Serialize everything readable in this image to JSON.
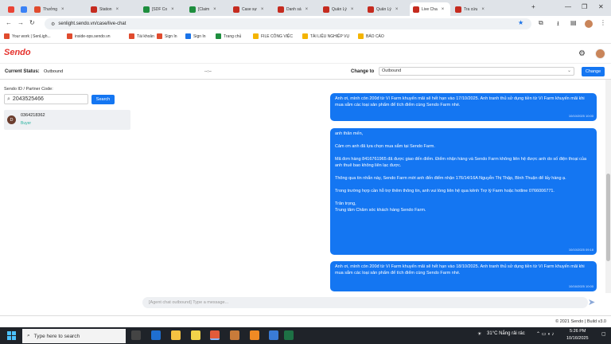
{
  "browser": {
    "tabs": [
      {
        "label": "",
        "color": "#ea4335",
        "icon": "gmail-icon"
      },
      {
        "label": "",
        "color": "#3b82f6",
        "icon": "messenger-icon"
      },
      {
        "label": "Thưởng",
        "color": "#e04b2e",
        "icon": "doc-icon"
      },
      {
        "label": "Station",
        "color": "#c52b1f",
        "icon": "station-icon"
      },
      {
        "label": "[SDF Co",
        "color": "#1e8e3e",
        "icon": "sheet-icon"
      },
      {
        "label": "[Claim",
        "color": "#1e8e3e",
        "icon": "sheet-icon"
      },
      {
        "label": "Case sự",
        "color": "#c52b1f",
        "icon": "station-icon"
      },
      {
        "label": "Danh sá",
        "color": "#c52b1f",
        "icon": "station-icon"
      },
      {
        "label": "Quản Lý",
        "color": "#c52b1f",
        "icon": "station-icon"
      },
      {
        "label": "Quản Lý",
        "color": "#c52b1f",
        "icon": "station-icon"
      },
      {
        "label": "Live Cha",
        "color": "#c52b1f",
        "icon": "station-icon",
        "active": true
      },
      {
        "label": "Tra cứu",
        "color": "#c52b1f",
        "icon": "station-icon"
      }
    ],
    "url": "senlight.sendo.vn/case/live-chat",
    "bookmarks": [
      {
        "label": "Your work | SenLigh...",
        "color": "#e04b2e"
      },
      {
        "label": "inside-ops.sendo.vn",
        "color": "#e04b2e"
      },
      {
        "label": "Tài khoản",
        "color": "#e04b2e"
      },
      {
        "label": "Sign In",
        "color": "#e04b2e"
      },
      {
        "label": "Sign In",
        "color": "#1a73e8"
      },
      {
        "label": "Trang chủ",
        "color": "#1e8e3e"
      },
      {
        "label": "FILE CÔNG VIỆC",
        "color": "#f4b400"
      },
      {
        "label": "TÀI LIỆU NGHIỆP VỤ",
        "color": "#f4b400"
      },
      {
        "label": "BÁO CÁO",
        "color": "#f4b400"
      }
    ]
  },
  "app": {
    "logo": "Sendo",
    "status": {
      "current_label": "Current Status:",
      "current_value": "Outbound",
      "middle_value": "--:--",
      "change_to_label": "Change to",
      "selected": "Outbound",
      "change_button": "Change"
    },
    "left": {
      "field_label": "Sendo ID / Partner Code:",
      "search_value": "2043525466",
      "search_button": "Search",
      "contact": {
        "initial": "D",
        "phone": "0364218362",
        "role": "Buyer"
      }
    },
    "messages": [
      {
        "text": "Anh ơi, mình còn 200đ từ Ví Farm khuyến mãi sẽ hết hạn vào 17/10/2025. Anh tranh thủ sử dụng tiền từ Ví Farm khuyến mãi khi mua sắm các loại sản phẩm để tích điểm cùng Sendo Farm nhé.",
        "time": "10/10/2025 10:00"
      },
      {
        "text": "anh thân mến,\n\nCảm ơn anh đã lựa chọn mua sắm tại Sendo Farm.\n\nMã đơn hàng 8416761965 đã được giao đến điểm. Điểm nhận hàng và Sendo Farm không liên hệ được anh do số điện thoại của anh thuê bao không liên lạc được.\n\nThông qua tin nhắn này, Sendo Farm mời anh đến điểm nhận 176/14/16A Nguyễn Thị Thập, Bình Thuận để lấy hàng ạ.\n\nTrong trường hợp cần hỗ trợ thêm thông tin, anh vui lòng liên hệ qua kênh Trợ lý Farm hoặc hotline 0766006771.\n\nTrân trọng,\nTrung tâm Chăm sóc khách hàng Sendo Farm.",
        "time": "10/10/2025 09:18"
      },
      {
        "text": "Anh ơi, mình còn 200đ từ Ví Farm khuyến mãi sẽ hết hạn vào 18/10/2025. Anh tranh thủ sử dụng tiền từ Ví Farm khuyến mãi khi mua sắm các loại sản phẩm để tích điểm cùng Sendo Farm nhé.",
        "time": "10/16/2025 10:00"
      }
    ],
    "composer_placeholder": "[Agent chat outbound] Type a message...",
    "footer": "© 2021 Sendo | Build v3.0"
  },
  "taskbar": {
    "search_placeholder": "Type here to search",
    "weather": "31°C  Nắng rải rác",
    "time": "5:26 PM",
    "date": "10/16/2025"
  },
  "colors": {
    "accent": "#1476f2",
    "brand": "#e5322d"
  }
}
